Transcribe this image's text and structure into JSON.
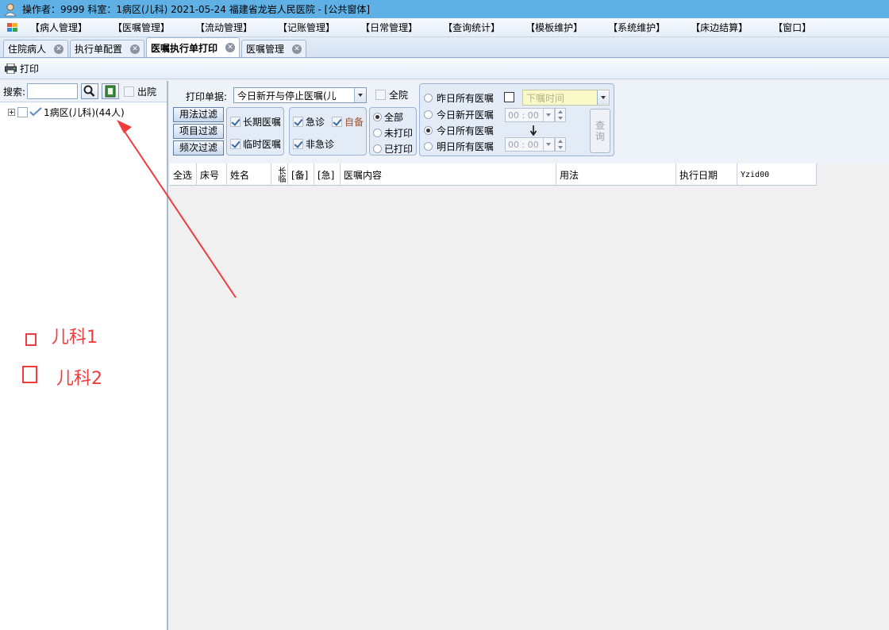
{
  "titlebar": {
    "title": "操作者：9999  科室：1病区(儿科)  2021-05-24  福建省龙岩人民医院 - [公共窗体]",
    "app_icon": "user-icon"
  },
  "menu": {
    "items": [
      "【病人管理】",
      "【医嘱管理】",
      "【流动管理】",
      "【记账管理】",
      "【日常管理】",
      "【查询统计】",
      "【模板维护】",
      "【系统维护】",
      "【床边结算】",
      "【窗口】"
    ]
  },
  "tabs": [
    {
      "label": "住院病人",
      "active": false
    },
    {
      "label": "执行单配置",
      "active": false
    },
    {
      "label": "医嘱执行单打印",
      "active": true
    },
    {
      "label": "医嘱管理",
      "active": false
    }
  ],
  "toolbar": {
    "print_label": "打印"
  },
  "left_panel": {
    "search_label": "搜索:",
    "search_value": "",
    "discharge_label": "出院",
    "tree_root": "1病区(儿科)(44人)"
  },
  "filters": {
    "print_basis_label": "打印单据:",
    "print_basis_value": "今日新开与停止医嘱(儿",
    "all_hospital_label": "全院",
    "usage_filter": "用法过滤",
    "item_filter": "项目过滤",
    "frequency_filter": "频次过滤",
    "long_term": "长期医嘱",
    "temporary": "临时医嘱",
    "emergency": "急诊",
    "self_provided": "自备",
    "non_emergency": "非急诊",
    "all": "全部",
    "not_printed": "未打印",
    "printed": "已打印",
    "yesterday_all": "昨日所有医嘱",
    "today_new": "今日新开医嘱",
    "today_all": "今日所有医嘱",
    "tomorrow_all": "明日所有医嘱",
    "order_time_placeholder": "下嘱时间",
    "time_from": "00 : 00",
    "time_to": "00 : 00",
    "query_label": "查询"
  },
  "grid": {
    "columns": [
      "全选",
      "床号",
      "姓名",
      "长临",
      "[备]",
      "[急]",
      "医嘱内容",
      "用法",
      "执行日期",
      "Yzid00"
    ]
  },
  "annotations": {
    "label1": "儿科1",
    "label2": "儿科2",
    "color": "#f03c3c"
  }
}
